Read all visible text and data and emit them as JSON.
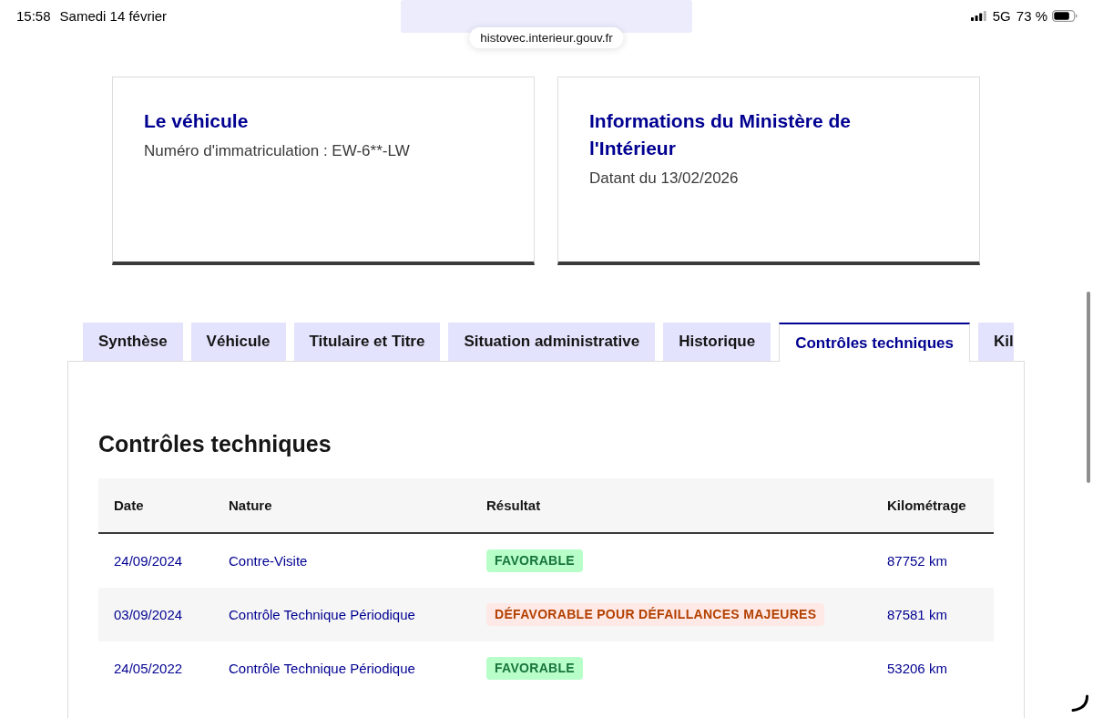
{
  "status_bar": {
    "time": "15:58",
    "date": "Samedi 14 février",
    "network": "5G",
    "battery": "73 %"
  },
  "address_bar": {
    "url": "histovec.interieur.gouv.fr"
  },
  "cards": [
    {
      "title": "Le véhicule",
      "text": "Numéro d'immatriculation : EW-6**-LW"
    },
    {
      "title": "Informations du Ministère de l'Intérieur",
      "text": "Datant du 13/02/2026"
    }
  ],
  "tabs": [
    {
      "label": "Synthèse",
      "selected": false
    },
    {
      "label": "Véhicule",
      "selected": false
    },
    {
      "label": "Titulaire et Titre",
      "selected": false
    },
    {
      "label": "Situation administrative",
      "selected": false
    },
    {
      "label": "Historique",
      "selected": false
    },
    {
      "label": "Contrôles techniques",
      "selected": true
    },
    {
      "label": "Kil",
      "selected": false
    }
  ],
  "section": {
    "title": "Contrôles techniques",
    "table": {
      "columns": [
        "Date",
        "Nature",
        "Résultat",
        "Kilométrage"
      ],
      "rows": [
        {
          "date": "24/09/2024",
          "nature": "Contre-Visite",
          "result": {
            "label": "FAVORABLE",
            "kind": "favorable"
          },
          "mileage": "87752 km"
        },
        {
          "date": "03/09/2024",
          "nature": "Contrôle Technique Périodique",
          "result": {
            "label": "DÉFAVORABLE POUR DÉFAILLANCES MAJEURES",
            "kind": "unfavorable"
          },
          "mileage": "87581 km"
        },
        {
          "date": "24/05/2022",
          "nature": "Contrôle Technique Périodique",
          "result": {
            "label": "FAVORABLE",
            "kind": "favorable"
          },
          "mileage": "53206 km"
        }
      ]
    }
  }
}
